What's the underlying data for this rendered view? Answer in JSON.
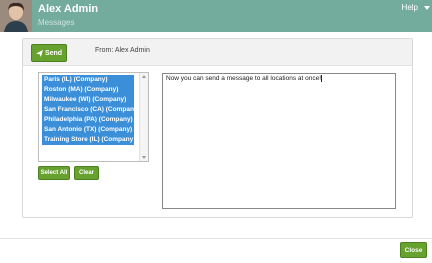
{
  "header": {
    "user_name": "Alex Admin",
    "subtitle": "Messages",
    "help_label": "Help"
  },
  "toolbar": {
    "send_label": "Send",
    "from_text": "From: Alex Admin"
  },
  "locations": {
    "items": [
      "Paris (IL) (Company)",
      "Roston (MA) (Company)",
      "Milwaukee (WI) (Company)",
      "San Francisco (CA) (Company",
      "Philadelphia (PA) (Company)",
      "San Antonio (TX) (Company)",
      "Training Store (IL) (Company"
    ],
    "select_all_label": "Select All",
    "clear_label": "Clear"
  },
  "message": {
    "value": "Now you can send a message to all locations at once!"
  },
  "footer": {
    "close_label": "Close"
  },
  "colors": {
    "header": "#73ab9d",
    "button": "#67a22f",
    "selection": "#3b8fd9"
  }
}
